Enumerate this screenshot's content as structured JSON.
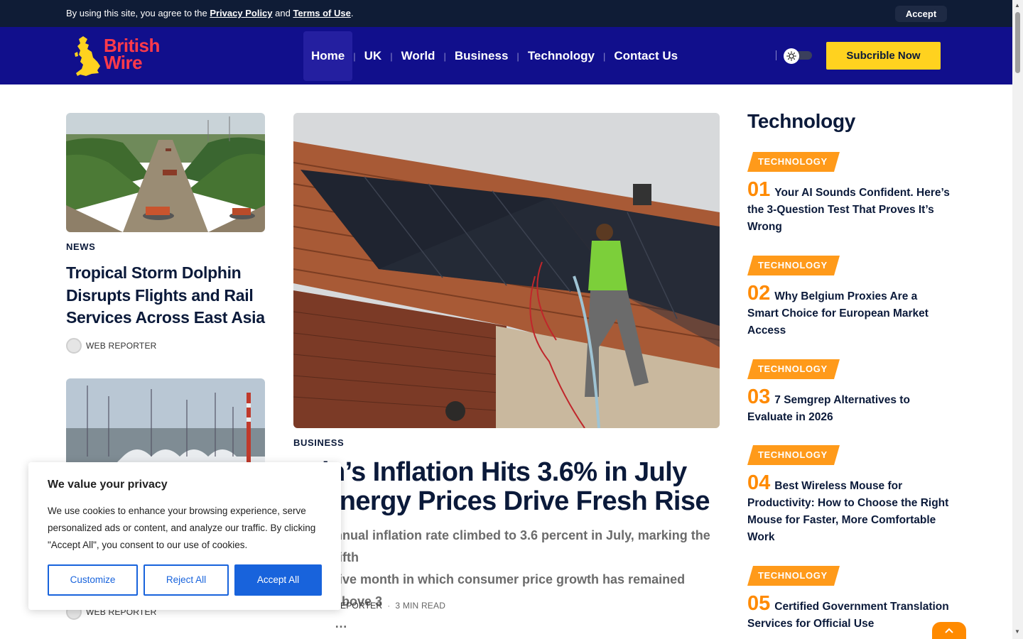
{
  "notice": {
    "prefix": "By using this site, you agree to the ",
    "privacy": "Privacy Policy",
    "and": " and ",
    "terms": "Terms of Use",
    "suffix": ".",
    "accept": "Accept"
  },
  "header": {
    "logo_line1": "British",
    "logo_line2": "Wire",
    "nav": [
      "Home",
      "UK",
      "World",
      "Business",
      "Technology",
      "Contact Us"
    ],
    "active_nav": "Home",
    "subscribe": "Subcrible Now",
    "theme_icon": "sun-icon"
  },
  "left": {
    "card1": {
      "tag": "NEWS",
      "title": "Tropical Storm Dolphin Disrupts Flights and Rail Services Across East Asia",
      "author": "WEB REPORTER"
    },
    "card2": {
      "author": "WEB REPORTER"
    }
  },
  "main": {
    "tag": "BUSINESS",
    "title_line1": "in’s Inflation Hits 3.6% in July",
    "title_line2": "Energy Prices Drive Fresh Rise",
    "excerpt_line1": "nnual inflation rate climbed to 3.6 percent in July, marking the fifth",
    "excerpt_line2": "tive month in which consumer price growth has remained above 3",
    "excerpt_line3": "…",
    "author": "EPORTER",
    "read_time": "3 MIN READ"
  },
  "sidebar": {
    "title": "Technology",
    "items": [
      {
        "tag": "TECHNOLOGY",
        "num": "01",
        "title": "Your AI Sounds Confident. Here’s the 3-Question Test That Proves It’s Wrong"
      },
      {
        "tag": "TECHNOLOGY",
        "num": "02",
        "title": "Why Belgium Proxies Are a Smart Choice for European Market Access"
      },
      {
        "tag": "TECHNOLOGY",
        "num": "03",
        "title": "7 Semgrep Alternatives to Evaluate in 2026"
      },
      {
        "tag": "TECHNOLOGY",
        "num": "04",
        "title": "Best Wireless Mouse for Productivity: How to Choose the Right Mouse for Faster, More Comfortable Work"
      },
      {
        "tag": "TECHNOLOGY",
        "num": "05",
        "title": "Certified Government Translation Services for Official Use"
      }
    ]
  },
  "cookie": {
    "title": "We value your privacy",
    "body": "We use cookies to enhance your browsing experience, serve personalized ads or content, and analyze our traffic. By clicking \"Accept All\", you consent to our use of cookies.",
    "customize": "Customize",
    "reject": "Reject All",
    "accept_all": "Accept All"
  },
  "colors": {
    "header_bg": "#110f8c",
    "accent_yellow": "#ffd21f",
    "accent_orange": "#ff8a00",
    "cookie_blue": "#1863dc"
  }
}
